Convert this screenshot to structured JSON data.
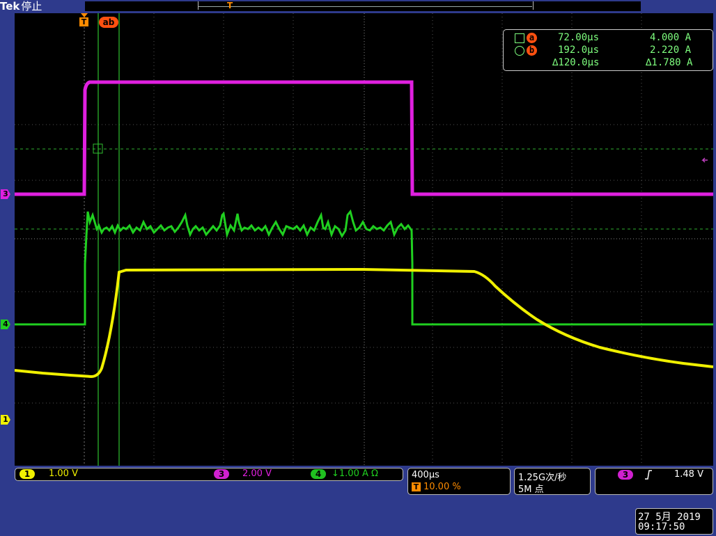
{
  "header": {
    "brand": "Tek",
    "status": "停止",
    "trigger_marker": "T"
  },
  "cursor_markers": {
    "trigger": "T",
    "ab": "ab"
  },
  "measurements": {
    "a": {
      "label": "a",
      "time": "72.00µs",
      "value": "4.000 A",
      "icon": "square-icon"
    },
    "b": {
      "label": "b",
      "time": "192.0µs",
      "value": "2.220 A",
      "icon": "circle-icon"
    },
    "delta": {
      "time": "∆120.0µs",
      "value": "∆1.780 A"
    }
  },
  "channel_markers": {
    "ch3": "3",
    "ch4": "4",
    "ch1": "1"
  },
  "channels": {
    "ch1": {
      "num": "1",
      "scale": "1.00 V",
      "color": "#ffff00"
    },
    "ch3": {
      "num": "3",
      "scale": "2.00 V",
      "color": "#e020e0"
    },
    "ch4": {
      "num": "4",
      "scale": "↓1.00 A  Ω",
      "color": "#20d020"
    }
  },
  "timebase": {
    "scale": "400µs",
    "trigger_label": "T",
    "trigger_pos": "10.00 %"
  },
  "acquisition": {
    "rate": "1.25G次/秒",
    "points": "5M 点"
  },
  "trigger": {
    "source": "3",
    "slope_icon": "rising-edge-icon",
    "level": "1.48 V"
  },
  "datetime": {
    "date": "27 5月  2019",
    "time": "09:17:50"
  }
}
